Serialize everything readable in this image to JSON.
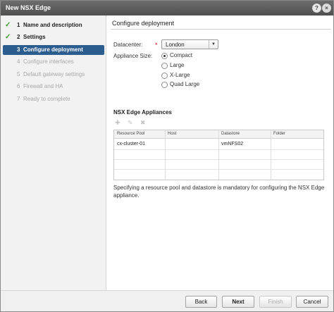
{
  "window": {
    "title": "New NSX Edge"
  },
  "steps": [
    {
      "num": "1",
      "label": "Name and description",
      "state": "done"
    },
    {
      "num": "2",
      "label": "Settings",
      "state": "done"
    },
    {
      "num": "3",
      "label": "Configure deployment",
      "state": "active"
    },
    {
      "num": "4",
      "label": "Configure interfaces",
      "state": "future"
    },
    {
      "num": "5",
      "label": "Default gateway settings",
      "state": "future"
    },
    {
      "num": "6",
      "label": "Firewall and HA",
      "state": "future"
    },
    {
      "num": "7",
      "label": "Ready to complete",
      "state": "future"
    }
  ],
  "main": {
    "title": "Configure deployment",
    "datacenter_label": "Datacenter:",
    "datacenter_required": "*",
    "datacenter_value": "London",
    "appliance_size_label": "Appliance Size:",
    "sizes": [
      {
        "label": "Compact",
        "checked": true
      },
      {
        "label": "Large",
        "checked": false
      },
      {
        "label": "X-Large",
        "checked": false
      },
      {
        "label": "Quad Large",
        "checked": false
      }
    ],
    "appliances_title": "NSX Edge Appliances",
    "columns": [
      "Resource Pool",
      "Host",
      "Datastore",
      "Folder"
    ],
    "rows": [
      [
        "cx-cluster-01",
        "",
        "vmNFS02",
        ""
      ]
    ],
    "note": "Specifying a resource pool and datastore is mandatory for configuring the NSX Edge appliance."
  },
  "footer": {
    "back": "Back",
    "next": "Next",
    "finish": "Finish",
    "cancel": "Cancel"
  },
  "icons": {
    "help": "?",
    "close": "×",
    "check": "✓",
    "add": "✚",
    "edit": "✎",
    "delete": "✖",
    "dropdown": "▼"
  }
}
